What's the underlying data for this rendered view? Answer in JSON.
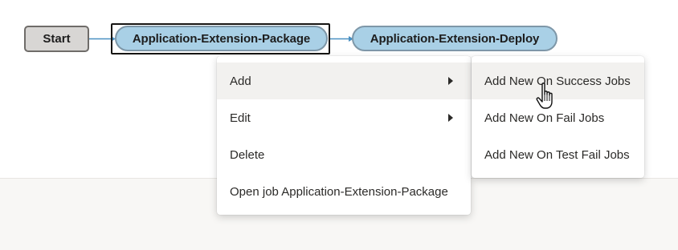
{
  "pipeline": {
    "nodes": [
      {
        "id": "start",
        "label": "Start"
      },
      {
        "id": "package",
        "label": "Application-Extension-Package",
        "selected": true
      },
      {
        "id": "deploy",
        "label": "Application-Extension-Deploy"
      }
    ],
    "colors": {
      "start_fill": "#d8d6d4",
      "job_fill": "#a9d0e6",
      "connector": "#4a90c2"
    }
  },
  "context_menu": {
    "items": [
      {
        "label": "Add",
        "has_submenu": true,
        "active": true
      },
      {
        "label": "Edit",
        "has_submenu": true
      },
      {
        "label": "Delete"
      },
      {
        "label": "Open job Application-Extension-Package"
      }
    ]
  },
  "submenu": {
    "items": [
      {
        "label": "Add New On Success Jobs",
        "hovered": true
      },
      {
        "label": "Add New On Fail Jobs"
      },
      {
        "label": "Add New On Test Fail Jobs"
      }
    ]
  },
  "cursor": {
    "icon": "hand-pointer-icon"
  }
}
